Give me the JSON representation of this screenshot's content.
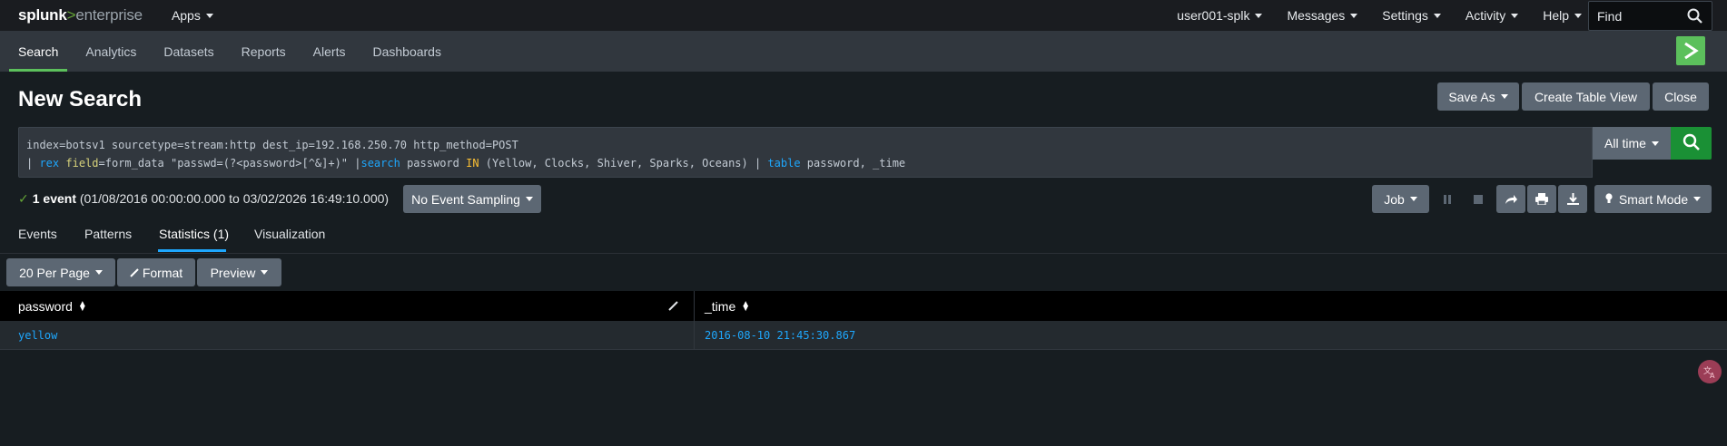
{
  "colors": {
    "accent_green": "#5cc05c",
    "link_blue": "#1ea7fd",
    "go_green": "#1a9035"
  },
  "topbar": {
    "logo_brand": "splunk",
    "logo_sep": ">",
    "logo_product": "enterprise",
    "apps_label": "Apps",
    "menus": [
      "user001-splk",
      "Messages",
      "Settings",
      "Activity",
      "Help"
    ],
    "find_placeholder": "Find"
  },
  "appnav": {
    "tabs": [
      "Search",
      "Analytics",
      "Datasets",
      "Reports",
      "Alerts",
      "Dashboards"
    ],
    "active": "Search"
  },
  "page": {
    "title": "New Search",
    "save_as": "Save As",
    "create_table_view": "Create Table View",
    "close": "Close"
  },
  "search": {
    "line1": "index=botsv1 sourcetype=stream:http dest_ip=192.168.250.70 http_method=POST",
    "line2": {
      "pipe1": "| ",
      "cmd1": "rex",
      "space1": " ",
      "arg1": "field",
      "rest1": "=form_data \"passwd=(?<password>[^&]+)\" |",
      "cmd2": "search",
      "rest2": " password ",
      "op": "IN",
      "rest3": " (Yellow, Clocks, Shiver, Sparks, Oceans) | ",
      "cmd3": "table",
      "rest4": " password, _time"
    },
    "time_range": "All time"
  },
  "status": {
    "event_count": "1 event",
    "range": "(01/08/2016 00:00:00.000 to 03/02/2026 16:49:10.000)",
    "sampling": "No Event Sampling",
    "job": "Job",
    "mode": "Smart Mode"
  },
  "result_tabs": [
    "Events",
    "Patterns",
    "Statistics (1)",
    "Visualization"
  ],
  "result_tab_active": "Statistics (1)",
  "toolbar": {
    "per_page": "20 Per Page",
    "format": "Format",
    "preview": "Preview"
  },
  "table": {
    "columns": [
      "password",
      "_time"
    ],
    "rows": [
      [
        "yellow",
        "2016-08-10 21:45:30.867"
      ]
    ]
  }
}
